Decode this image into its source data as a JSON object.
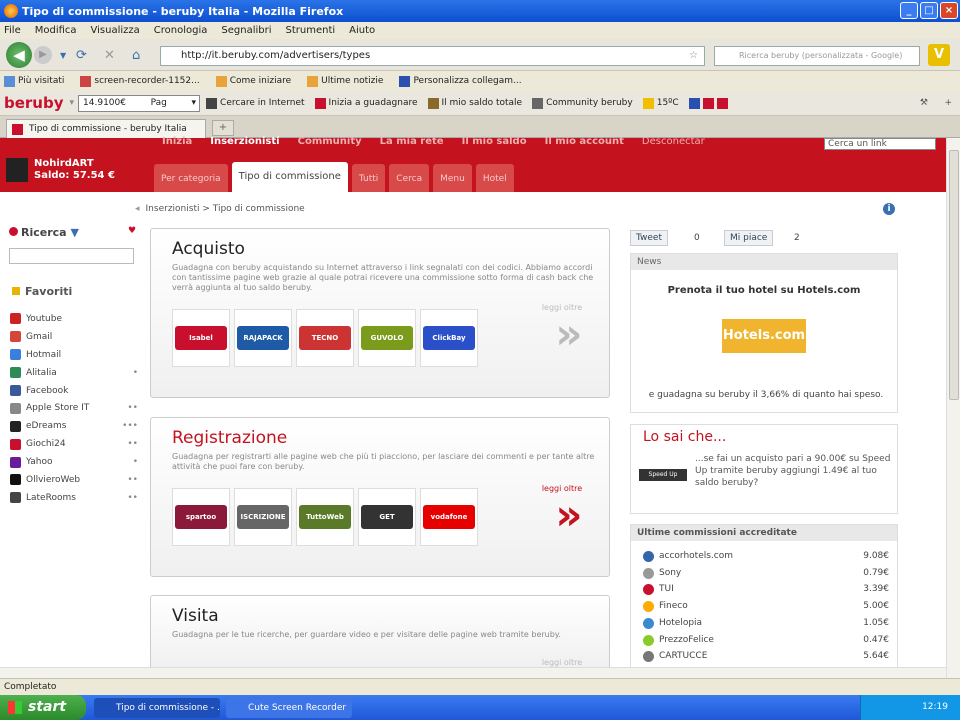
{
  "window": {
    "title": "Tipo di commissione - beruby Italia - Mozilla Firefox",
    "buttons": [
      "_",
      "□",
      "×"
    ]
  },
  "menu": [
    "File",
    "Modifica",
    "Visualizza",
    "Cronologia",
    "Segnalibri",
    "Strumenti",
    "Aiuto"
  ],
  "nav": {
    "url": "http://it.beruby.com/advertisers/types",
    "search_placeholder": "Ricerca beruby (personalizzata - Google)"
  },
  "bookmarks": [
    "Più visitati",
    "screen-recorder-1152...",
    "Come iniziare",
    "Ultime notizie",
    "Personalizza collegam..."
  ],
  "toolbar": {
    "logo": "beruby",
    "balance": "14.9100€",
    "pag": "Pag",
    "items": [
      "Cercare in Internet",
      "Inizia a guadagnare",
      "Il mio saldo totale",
      "Community beruby",
      "15ºC"
    ]
  },
  "tab": {
    "label": "Tipo di commissione - beruby Italia"
  },
  "site": {
    "topnav": [
      "Inizia",
      "Inserzionisti",
      "Community",
      "La mia rete",
      "Il mio saldo",
      "Il mio account",
      "Desconectar"
    ],
    "topsearch": "Cerca un link",
    "user": {
      "name": "NohirdART",
      "balance": "Saldo: 57.54 €"
    },
    "subtabs": [
      "Per categoria",
      "Tipo di commissione",
      "Tutti",
      "Cerca",
      "Menu",
      "Hotel"
    ],
    "active_subtab": 1
  },
  "breadcrumb": "Inserzionisti > Tipo di commissione",
  "sidebar": {
    "search_title": "Ricerca",
    "fav_title": "Favoriti",
    "favorites": [
      {
        "name": "Youtube",
        "color": "#cc2222",
        "action": ""
      },
      {
        "name": "Gmail",
        "color": "#d44638",
        "action": ""
      },
      {
        "name": "Hotmail",
        "color": "#3a7ee0",
        "action": ""
      },
      {
        "name": "Alitalia",
        "color": "#2e8b57",
        "action": "•"
      },
      {
        "name": "Facebook",
        "color": "#3b5998",
        "action": ""
      },
      {
        "name": "Apple Store IT",
        "color": "#888888",
        "action": "••"
      },
      {
        "name": "eDreams",
        "color": "#222222",
        "action": "•••"
      },
      {
        "name": "Giochi24",
        "color": "#c8102e",
        "action": "••"
      },
      {
        "name": "Yahoo",
        "color": "#6a1b9a",
        "action": "•"
      },
      {
        "name": "OllvieroWeb",
        "color": "#111111",
        "action": "••"
      },
      {
        "name": "LateRooms",
        "color": "#444444",
        "action": "••"
      }
    ]
  },
  "cards": [
    {
      "title": "Acquisto",
      "desc": "Guadagna con beruby acquistando su Internet attraverso i link segnalati con dei codici. Abbiamo accordi con tantissime pagine web grazie al quale potrai ricevere una commissione sotto forma di cash back che verrà aggiunta al tuo saldo beruby.",
      "logos": [
        {
          "t": "Isabel",
          "c": "#c8102e"
        },
        {
          "t": "RAJAPACK",
          "c": "#1f5aa6"
        },
        {
          "t": "TECNO",
          "c": "#cc3333"
        },
        {
          "t": "GUVOLO",
          "c": "#7a9b1c"
        },
        {
          "t": "ClickBay",
          "c": "#2b4fc8"
        }
      ],
      "more": "leggi oltre",
      "active": false
    },
    {
      "title": "Registrazione",
      "desc": "Guadagna per registrarti alle pagine web che più ti piacciono, per lasciare dei commenti e per tante altre attività che puoi fare con beruby.",
      "logos": [
        {
          "t": "spartoo",
          "c": "#8b1a3a"
        },
        {
          "t": "ISCRIZIONE",
          "c": "#666666"
        },
        {
          "t": "TuttoWeb",
          "c": "#5a7a2a"
        },
        {
          "t": "GET",
          "c": "#333333"
        },
        {
          "t": "vodafone",
          "c": "#e60000"
        }
      ],
      "more": "leggi oltre",
      "active": true
    },
    {
      "title": "Visita",
      "desc": "Guadagna per le tue ricerche, per guardare video e per visitare delle pagine web tramite beruby.",
      "logos": [],
      "more": "leggi oltre",
      "active": false
    }
  ],
  "right": {
    "tweet": "Tweet",
    "tweet_count": "0",
    "like": "Mi piace",
    "like_count": "2",
    "news_title": "News",
    "promo": "Prenota il tuo hotel su Hotels.com",
    "hotels": "Hotels.com",
    "gain": "e guadagna su beruby il 3,66% di quanto hai speso.",
    "losai_title": "Lo sai che...",
    "speedup": "Speed Up",
    "losai_text": "...se fai un acquisto pari a 90.00€ su Speed Up tramite beruby aggiungi 1.49€ al tuo saldo beruby?",
    "ultime_title": "Ultime commissioni accreditate",
    "ultime": [
      {
        "name": "accorhotels.com",
        "value": "9.08€",
        "color": "#3366aa"
      },
      {
        "name": "Sony",
        "value": "0.79€",
        "color": "#999999"
      },
      {
        "name": "TUI",
        "value": "3.39€",
        "color": "#c8102e"
      },
      {
        "name": "Fineco",
        "value": "5.00€",
        "color": "#ffaa00"
      },
      {
        "name": "Hotelopia",
        "value": "1.05€",
        "color": "#3a8ad0"
      },
      {
        "name": "PrezzoFelice",
        "value": "0.47€",
        "color": "#8acb2a"
      },
      {
        "name": "CARTUCCE",
        "value": "5.64€",
        "color": "#777777"
      }
    ]
  },
  "status": "Completato",
  "taskbar": {
    "start": "start",
    "tasks": [
      "Tipo di commissione - ...",
      "Cute Screen Recorder"
    ],
    "time": "12:19"
  }
}
